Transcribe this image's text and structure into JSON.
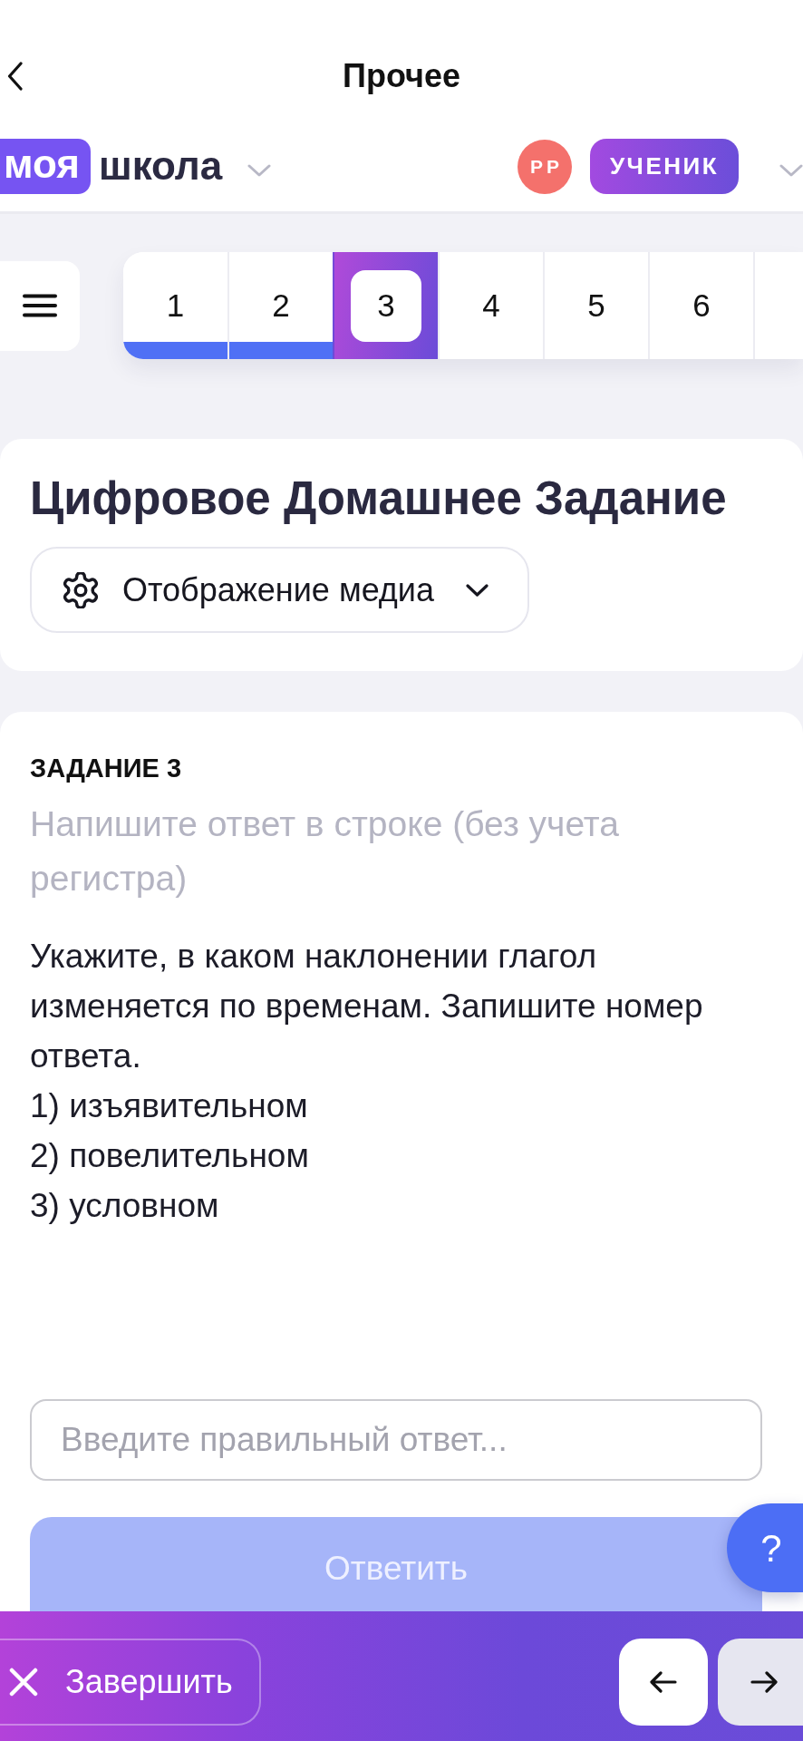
{
  "header": {
    "title": "Прочее"
  },
  "school": {
    "logo_badge": "моя",
    "logo_text": "школа"
  },
  "user": {
    "initials": "РР",
    "role": "УЧЕНИК"
  },
  "questions": [
    {
      "label": "1",
      "answered": true,
      "selected": false
    },
    {
      "label": "2",
      "answered": true,
      "selected": false
    },
    {
      "label": "3",
      "answered": false,
      "selected": true
    },
    {
      "label": "4",
      "answered": false,
      "selected": false
    },
    {
      "label": "5",
      "answered": false,
      "selected": false
    },
    {
      "label": "6",
      "answered": false,
      "selected": false
    }
  ],
  "homework": {
    "title": "Цифровое Домашнее Задание",
    "media_dropdown": "Отображение медиа"
  },
  "task": {
    "heading": "ЗАДАНИЕ 3",
    "instruction": "Напишите ответ в строке (без учета регистра)",
    "question": "Укажите, в каком наклонении глагол изменяется по временам. Запишите номер ответа.",
    "options": [
      "1) изъявительном",
      "2) повелительном",
      "3) условном"
    ],
    "answer_field": {
      "placeholder": "Введите правильный ответ..."
    },
    "submit": {
      "label": "Ответить",
      "disabled": true
    }
  },
  "help_button": {
    "label": "?"
  },
  "bottom_bar": {
    "finish": "Завершить"
  }
}
